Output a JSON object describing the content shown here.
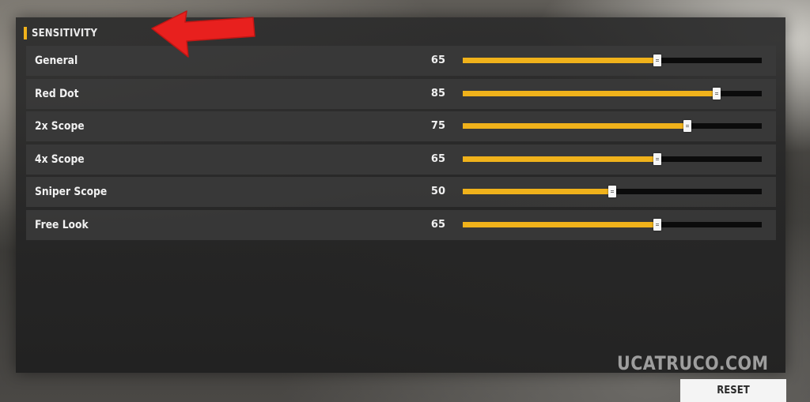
{
  "header": {
    "title": "SENSITIVITY",
    "accent_color": "#f0b21b"
  },
  "annotation": {
    "icon": "red-arrow-icon",
    "color": "#e8201e"
  },
  "slider_max": 100,
  "sliders": [
    {
      "label": "General",
      "value": 65
    },
    {
      "label": "Red Dot",
      "value": 85
    },
    {
      "label": "2x Scope",
      "value": 75
    },
    {
      "label": "4x Scope",
      "value": 65
    },
    {
      "label": "Sniper Scope",
      "value": 50
    },
    {
      "label": "Free Look",
      "value": 65
    }
  ],
  "watermark": "UCATRUCO.COM",
  "reset_label": "RESET"
}
